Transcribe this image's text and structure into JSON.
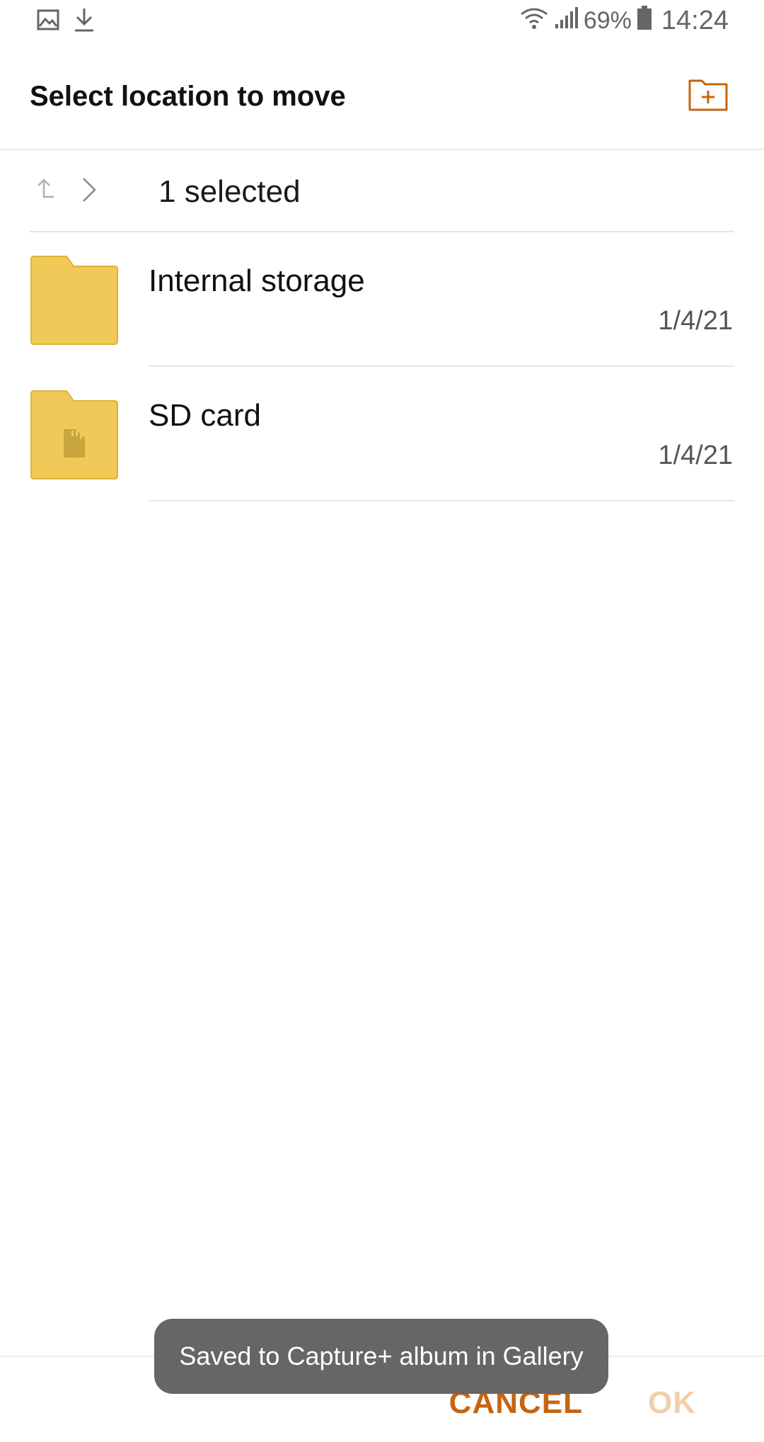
{
  "status_bar": {
    "notification_icons": [
      "gallery-icon",
      "download-icon"
    ],
    "wifi_icon": "wifi-icon",
    "signal_icon": "signal-icon",
    "battery_percent": "69%",
    "battery_icon": "battery-icon",
    "time": "14:24"
  },
  "header": {
    "title": "Select location to move",
    "new_folder_icon": "new-folder-icon"
  },
  "breadcrumb": {
    "up_icon": "up-arrow-icon",
    "chevron_icon": "chevron-right-icon",
    "selected_text": "1 selected"
  },
  "locations": [
    {
      "name": "Internal storage",
      "date": "1/4/21",
      "icon": "folder-icon"
    },
    {
      "name": "SD card",
      "date": "1/4/21",
      "icon": "sd-card-folder-icon"
    }
  ],
  "buttons": {
    "cancel": "CANCEL",
    "ok": "OK"
  },
  "toast": {
    "message": "Saved to Capture+ album in Gallery"
  },
  "colors": {
    "accent": "#c5650f",
    "accent_disabled": "#f2cfaa",
    "folder": "#f0ca58",
    "folder_border": "#e0b23a",
    "toast_bg": "#666666"
  }
}
